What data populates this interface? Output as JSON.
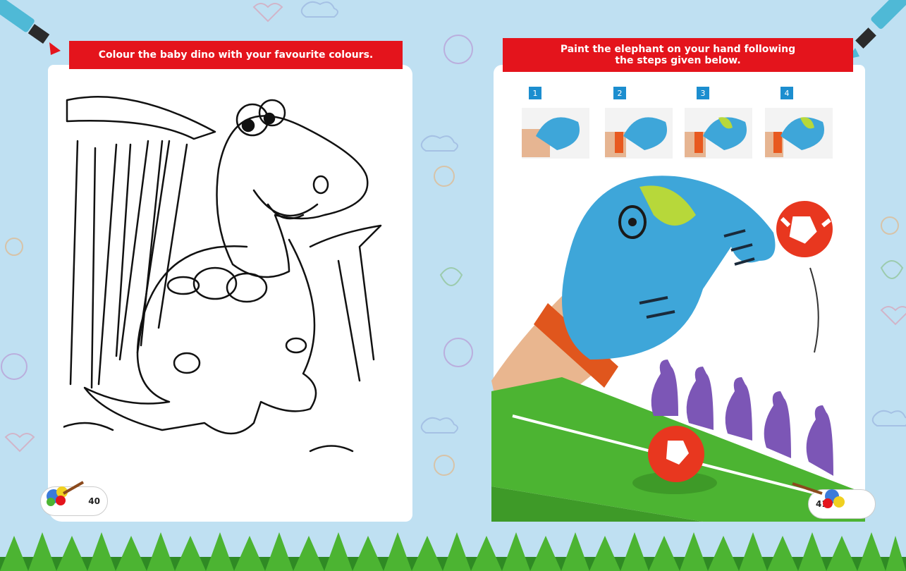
{
  "left_page": {
    "instruction": "Colour the baby dino with your favourite colours.",
    "page_number": "40"
  },
  "right_page": {
    "instruction_line1": "Paint the elephant on your hand following",
    "instruction_line2": "the steps given below.",
    "steps": [
      "1",
      "2",
      "3",
      "4"
    ],
    "page_number": "41"
  },
  "colors": {
    "banner_red": "#e4141c",
    "background_blue": "#bfe0f2",
    "step_badge_blue": "#1c8ecf",
    "hand_blue": "#3ea6d9",
    "field_green": "#4cb432",
    "ball_red": "#e8371f",
    "pin_purple": "#7c56b6"
  }
}
